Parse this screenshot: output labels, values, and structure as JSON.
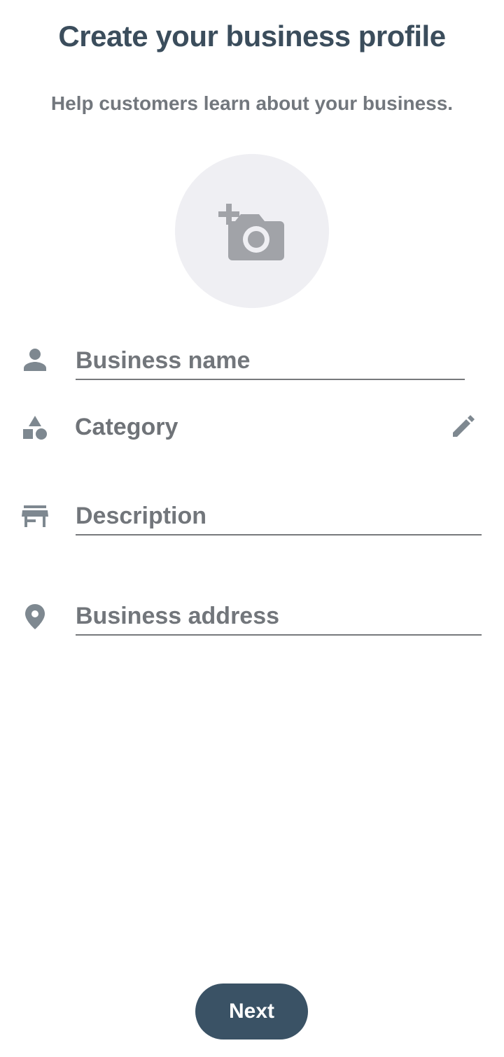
{
  "header": {
    "title": "Create your business profile",
    "subtitle": "Help customers learn about your business."
  },
  "photo": {
    "icon": "add-photo-icon"
  },
  "form": {
    "business_name": {
      "icon": "person-icon",
      "placeholder": "Business name",
      "value": ""
    },
    "category": {
      "icon": "category-shapes-icon",
      "label": "Category",
      "edit_icon": "pencil-icon"
    },
    "description": {
      "icon": "storefront-icon",
      "placeholder": "Description",
      "value": ""
    },
    "address": {
      "icon": "location-pin-icon",
      "placeholder": "Business address",
      "value": ""
    }
  },
  "footer": {
    "next_label": "Next"
  },
  "colors": {
    "title": "#3b4d5c",
    "muted_text": "#72777d",
    "icon": "#7e8890",
    "photo_bg": "#efeff3",
    "photo_icon": "#a1a3a8",
    "button_bg": "#3a5265",
    "button_text": "#ffffff"
  }
}
